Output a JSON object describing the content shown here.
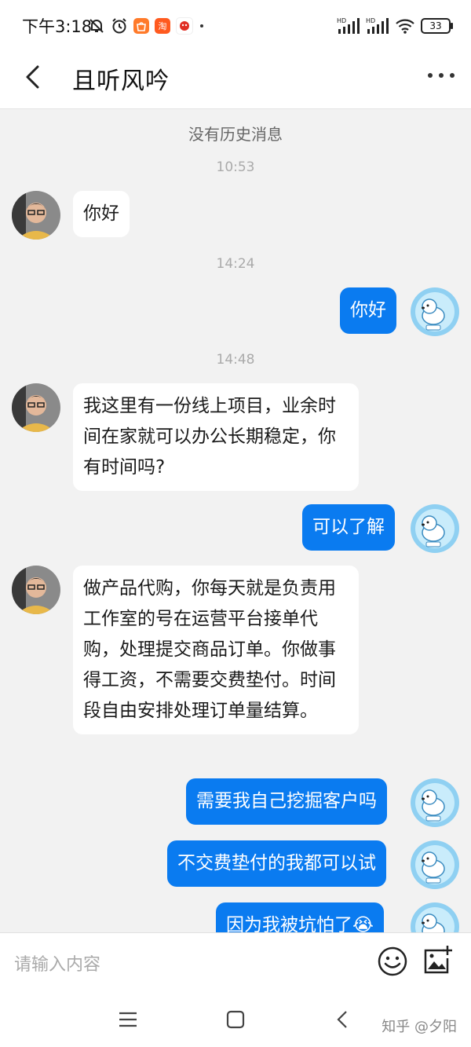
{
  "status_bar": {
    "time": "下午3:18",
    "battery": "33",
    "signal_label": "HD",
    "app_badge_tao": "淘"
  },
  "header": {
    "title": "且听风吟"
  },
  "chat": {
    "no_history": "没有历史消息",
    "timestamps": [
      "10:53",
      "14:24",
      "14:48"
    ],
    "messages": [
      {
        "text": "你好"
      },
      {
        "text": "你好"
      },
      {
        "text": "我这里有一份线上项目，业余时间在家就可以办公长期稳定，你有时间吗?"
      },
      {
        "text": "可以了解"
      },
      {
        "text": "做产品代购，你每天就是负责用工作室的号在运营平台接单代购，处理提交商品订单。你做事得工资，不需要交费垫付。时间\n段自由安排处理订单量结算。"
      },
      {
        "text": "需要我自己挖掘客户吗"
      },
      {
        "text": "不交费垫付的我都可以试"
      },
      {
        "text": "因为我被坑怕了😭"
      }
    ]
  },
  "input": {
    "placeholder": "请输入内容"
  },
  "watermark": "知乎 @夕阳",
  "colors": {
    "accent": "#0a7bf0",
    "background": "#f2f2f2"
  },
  "icons": [
    "back-arrow-icon",
    "more-dots-icon",
    "emoji-icon",
    "image-add-icon",
    "menu-icon",
    "home-icon",
    "nav-back-icon"
  ]
}
